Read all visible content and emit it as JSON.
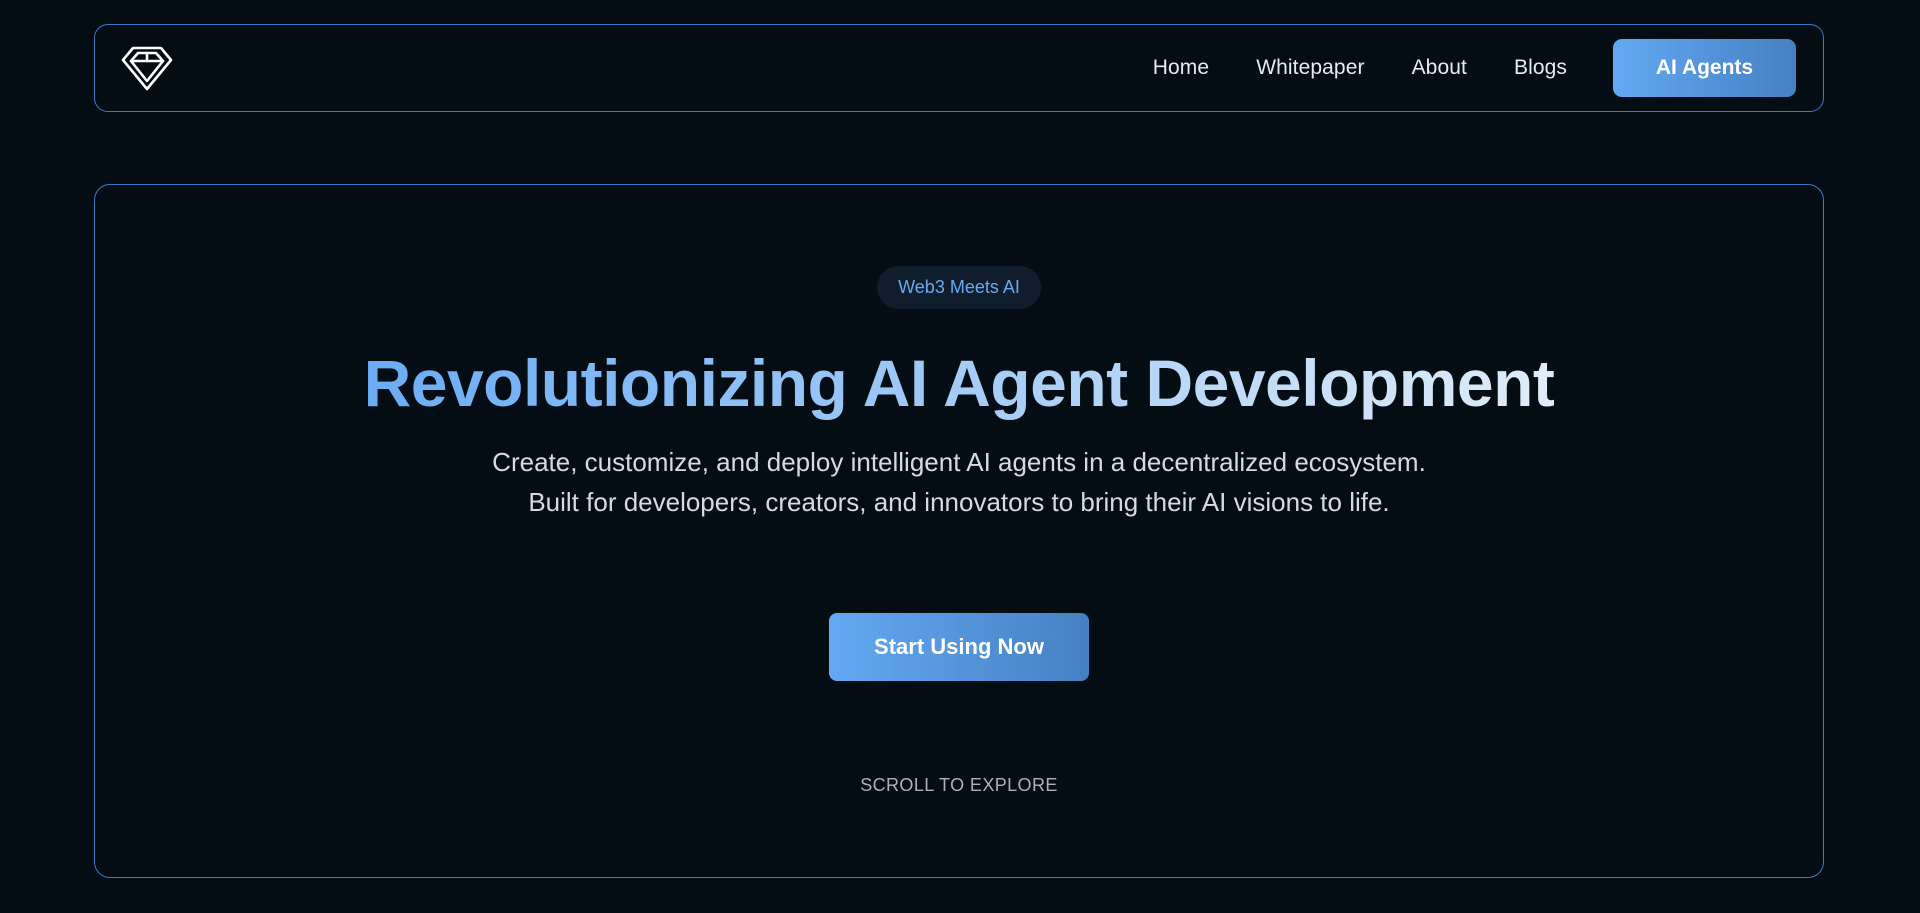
{
  "navbar": {
    "logo_icon": "diamond-logo-icon",
    "links": [
      "Home",
      "Whitepaper",
      "About",
      "Blogs"
    ],
    "cta_label": "AI Agents"
  },
  "hero": {
    "badge": "Web3 Meets AI",
    "headline": "Revolutionizing AI Agent Development",
    "subtext": "Create, customize, and deploy intelligent AI agents in a decentralized ecosystem. Built for developers, creators, and innovators to bring their AI visions to life.",
    "cta_label": "Start Using Now",
    "scroll_hint": "SCROLL TO EXPLORE"
  },
  "colors": {
    "background": "#040c14",
    "border_accent": "#3f78c8",
    "button_gradient_start": "#63a9f3",
    "button_gradient_end": "#4680c2",
    "badge_text": "#69a9ef",
    "badge_background": "#0f1d2c"
  }
}
